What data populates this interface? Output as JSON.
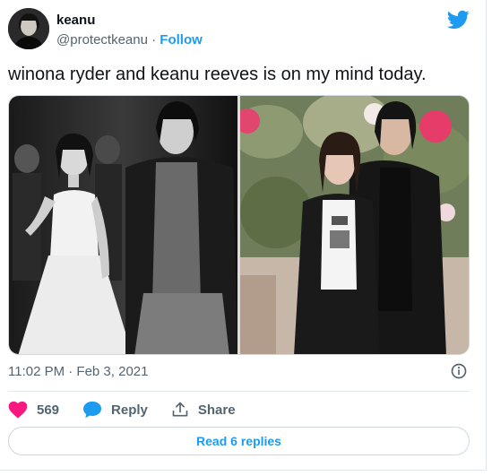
{
  "author": {
    "display_name": "keanu",
    "handle": "@protectkeanu",
    "separator": " · ",
    "follow_label": "Follow"
  },
  "tweet": {
    "text": "winona ryder and keanu reeves is on my mind today.",
    "timestamp": "11:02 PM · Feb 3, 2021"
  },
  "media": {
    "left_image": "black-and-white-photo-couple",
    "right_image": "color-photo-couple-with-plants"
  },
  "actions": {
    "like_count": "569",
    "reply_label": "Reply",
    "share_label": "Share"
  },
  "read_replies_label": "Read 6 replies",
  "colors": {
    "accent": "#1d9bf0",
    "like": "#f91880",
    "text_secondary": "#536471"
  },
  "icons": [
    "twitter-bird-icon",
    "info-icon",
    "heart-icon",
    "reply-bubble-icon",
    "share-icon"
  ]
}
